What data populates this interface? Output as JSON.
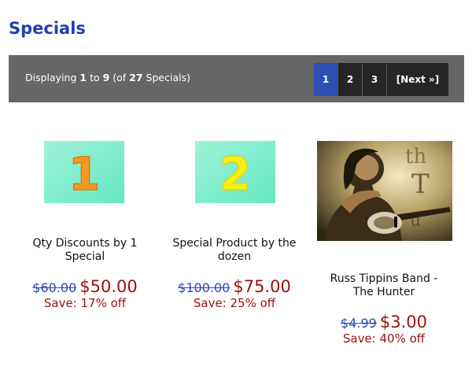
{
  "page": {
    "title": "Specials"
  },
  "pager": {
    "prefix": "Displaying ",
    "from": "1",
    "to_word": " to ",
    "to": "9",
    "of_prefix": " (of ",
    "total": "27",
    "suffix": " Specials)",
    "pages": [
      "1",
      "2",
      "3"
    ],
    "current_page": "1",
    "next_label": "[Next »]"
  },
  "products": [
    {
      "image_digit": "1",
      "name_line1": "Qty Discounts by 1",
      "name_line2": "Special",
      "old_price": "$60.00",
      "new_price": "$50.00",
      "save": "Save: 17% off"
    },
    {
      "image_digit": "2",
      "name_line1": "Special Product by the",
      "name_line2": "dozen",
      "old_price": "$100.00",
      "new_price": "$75.00",
      "save": "Save: 25% off"
    },
    {
      "name_line1": "Russ Tippins Band -",
      "name_line2": "The Hunter",
      "old_price": "$4.99",
      "new_price": "$3.00",
      "save": "Save: 40% off"
    }
  ],
  "colors": {
    "title": "#1f3eb3",
    "pager_bg": "#666666",
    "current_page_bg": "#2d4fb4",
    "page_bg": "#262626",
    "old_price": "#2a47b8",
    "sale_price": "#9a1010"
  }
}
